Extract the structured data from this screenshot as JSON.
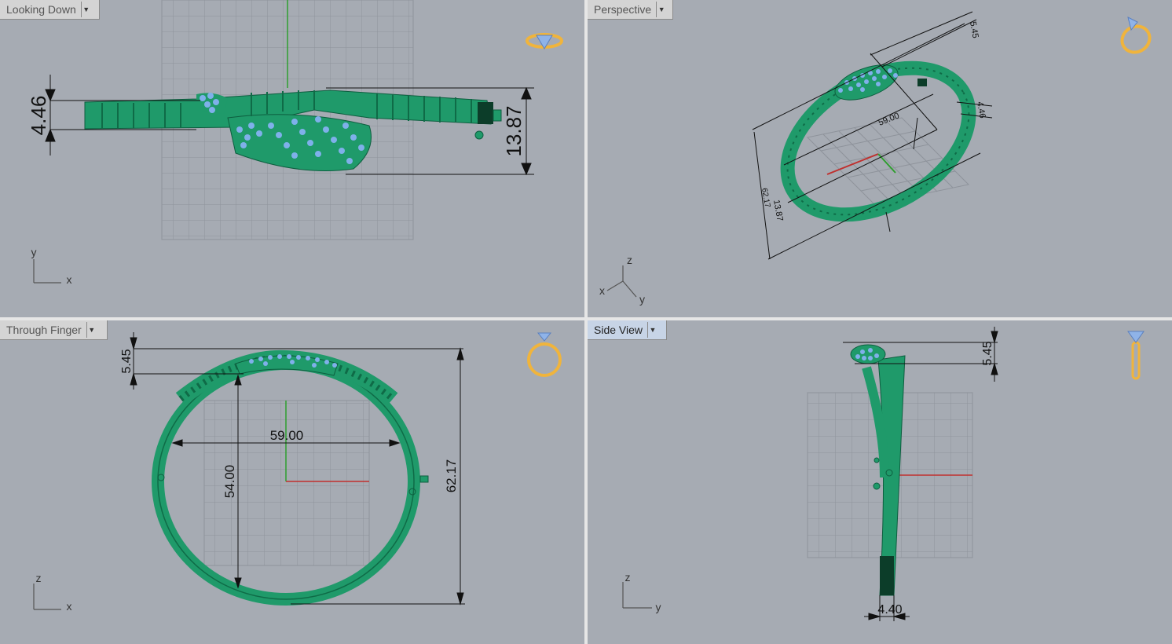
{
  "viewports": {
    "looking_down": {
      "title": "Looking Down",
      "dim_height": "4.46",
      "dim_width": "13.87",
      "axis_v": "y",
      "axis_h": "x"
    },
    "perspective": {
      "title": "Perspective",
      "dim_a": "59.00",
      "dim_b": "13.87",
      "dim_c": "5.45",
      "dim_d": "4.46",
      "dim_e": "62.17",
      "axis_z": "z",
      "axis_x": "x",
      "axis_y": "y"
    },
    "through_finger": {
      "title": "Through Finger",
      "dim_top": "5.45",
      "dim_width": "59.00",
      "dim_height": "54.00",
      "dim_outer": "62.17",
      "axis_v": "z",
      "axis_h": "x"
    },
    "side_view": {
      "title": "Side View",
      "dim_top": "5.45",
      "dim_bottom": "4.40",
      "axis_v": "z",
      "axis_h": "y"
    }
  },
  "colors": {
    "viewport_bg": "#a6abb3",
    "model": "#1f9a6a",
    "gem": "#7fb0ea",
    "active_tab": "#c7d4e6",
    "icon": "#f0b43c"
  },
  "icons": [
    "ring-top-icon",
    "ring-perspective-icon",
    "ring-front-icon",
    "ring-side-icon"
  ]
}
